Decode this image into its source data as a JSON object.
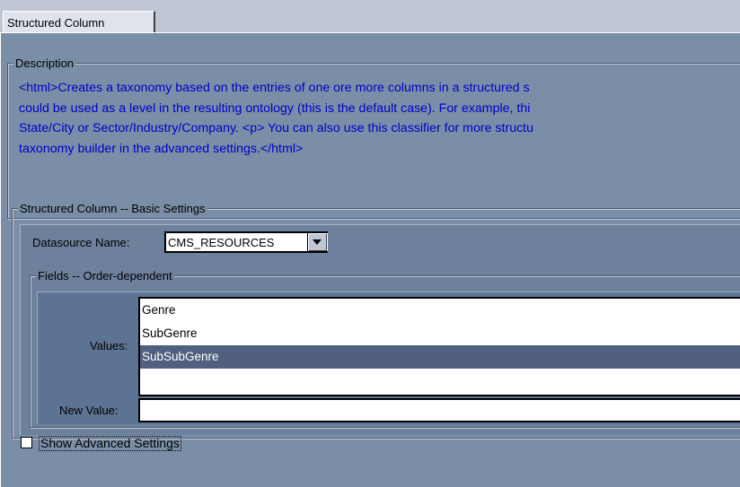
{
  "tabs": [
    {
      "label": "Structured Column",
      "selected": true
    }
  ],
  "description": {
    "legend": "Description",
    "lines": [
      "<html>Creates a taxonomy based on the entries of one ore more columns in a structured s",
      "could be used as a level in the resulting ontology (this is the default case).  For example, thi",
      "State/City or Sector/Industry/Company.  <p>  You can also use this classifier for more structu",
      "taxonomy builder in the advanced settings.</html>"
    ],
    "text_color": "#0000c8"
  },
  "basic_settings": {
    "legend": "Structured Column -- Basic Settings",
    "datasource_label": "Datasource Name:",
    "datasource_value": "CMS_RESOURCES",
    "fields": {
      "legend": "Fields -- Order-dependent",
      "values_label": "Values:",
      "values": [
        "Genre",
        "SubGenre",
        "SubSubGenre",
        ""
      ],
      "selected_index": 2,
      "new_value_label": "New Value:",
      "new_value": ""
    }
  },
  "advanced": {
    "label": "Show Advanced Settings",
    "checked": false
  },
  "colors": {
    "panel_bg": "#7a8ea7",
    "selection_bg": "#50607e"
  }
}
